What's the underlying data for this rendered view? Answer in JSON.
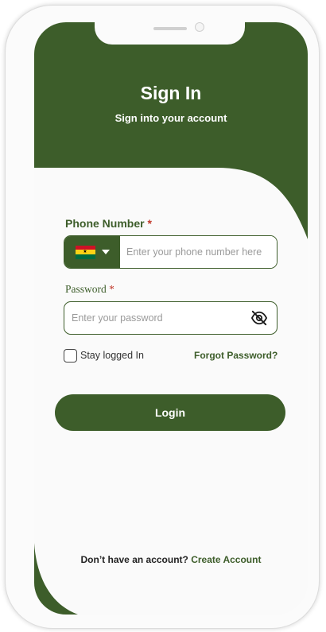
{
  "header": {
    "title": "Sign In",
    "subtitle": "Sign into your account"
  },
  "phone": {
    "label": "Phone Number",
    "required_mark": "*",
    "country": "ghana-flag",
    "placeholder": "Enter your phone number here"
  },
  "password": {
    "label": "Password",
    "required_mark": "*",
    "placeholder": "Enter your password"
  },
  "options": {
    "stay_logged_in_label": "Stay logged In",
    "stay_logged_in_checked": false,
    "forgot_password": "Forgot Password?"
  },
  "login_button": "Login",
  "footer": {
    "prompt": "Don’t  have an account?",
    "link": "Create Account"
  },
  "colors": {
    "primary": "#3d5d2a",
    "background": "#fafafa",
    "required": "#c0392b"
  }
}
